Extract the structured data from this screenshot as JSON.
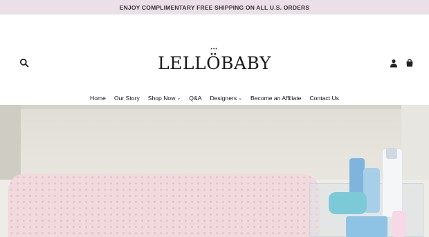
{
  "announcement": "ENJOY COMPLIMENTARY FREE SHIPPING ON ALL U.S. ORDERS",
  "header": {
    "logo_pre": "LELL",
    "logo_mid": "Ö",
    "logo_post": "BABY"
  },
  "nav": {
    "items": [
      {
        "label": "Home"
      },
      {
        "label": "Our Story"
      },
      {
        "label": "Shop Now",
        "dropdown": true
      },
      {
        "label": "Q&A"
      },
      {
        "label": "Designers",
        "dropdown": true
      },
      {
        "label": "Become an Affiliate"
      },
      {
        "label": "Contact Us"
      }
    ]
  },
  "icons": {
    "search": "search-icon",
    "account": "account-icon",
    "cart": "cart-icon"
  },
  "colors": {
    "announcement_bg": "#ece0e8",
    "pad_pink": "#f1d9de"
  }
}
